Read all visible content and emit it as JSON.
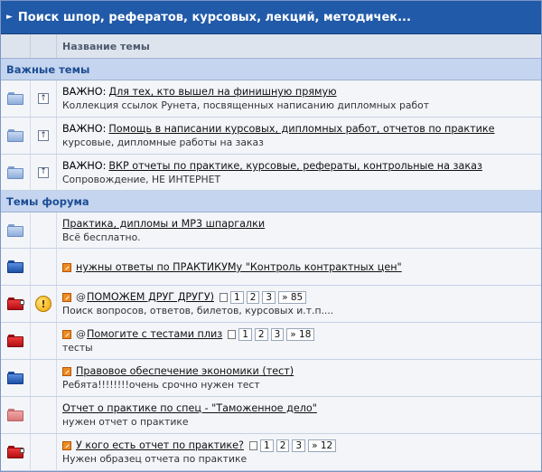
{
  "forum_title": "Поиск шпор, рефератов, курсовых, лекций, методичек...",
  "column_header": "Название темы",
  "sections": {
    "important": "Важные темы",
    "forum": "Темы форума"
  },
  "important_topics": [
    {
      "prefix": "ВАЖНО:",
      "title": "Для тех, кто вышел на финишную прямую",
      "desc": "Коллекция ссылок Рунета, посвященных написанию дипломных работ",
      "icon": "folder-light-icon"
    },
    {
      "prefix": "ВАЖНО:",
      "title": "Помощь в написании курсовых, дипломных работ, отчетов по практике",
      "desc": "курсовые, дипломные работы на заказ",
      "icon": "folder-light-icon"
    },
    {
      "prefix": "ВАЖНО:",
      "title": "ВКР отчеты по практике, курсовые, рефераты, контрольные на заказ",
      "desc": "Сопровождение, НЕ ИНТЕРНЕТ",
      "icon": "folder-light-icon"
    }
  ],
  "forum_topics": [
    {
      "title": "Практика, дипломы и МР3 шпаргалки",
      "desc": "Всё бесплатно.",
      "icon": "folder-light-icon"
    },
    {
      "title": "нужны ответы по ПРАКТИКУМу \"Контроль контрактных цен\"",
      "desc": "",
      "icon": "folder-blue-icon"
    },
    {
      "title": "ПОМОЖЕМ ДРУГ ДРУГУ)",
      "desc": "Поиск вопросов, ответов, билетов, курсовых и.т.п....",
      "icon": "folder-red-icon",
      "pages": [
        "1",
        "2",
        "3",
        "» 85"
      ]
    },
    {
      "title": "Помогите с тестами плиз",
      "desc": "тесты",
      "icon": "folder-red-icon",
      "pages": [
        "1",
        "2",
        "3",
        "» 18"
      ]
    },
    {
      "title": "Правовое обеспечение экономики (тест)",
      "desc": "Ребята!!!!!!!!очень срочно нужен тест",
      "icon": "folder-blue-icon"
    },
    {
      "title": "Отчет о практике по спец - \"Таможенное дело\"",
      "desc": "нужен отчет о практике",
      "icon": "folder-pink-icon"
    },
    {
      "title": "У кого есть отчет по практике?",
      "desc": "Нужен образец отчета по практике",
      "icon": "folder-red-icon",
      "pages": [
        "1",
        "2",
        "3",
        "» 12"
      ]
    }
  ],
  "hot_icon_glyph": "!",
  "attach_glyph": "@",
  "sticky_glyph": "↑"
}
